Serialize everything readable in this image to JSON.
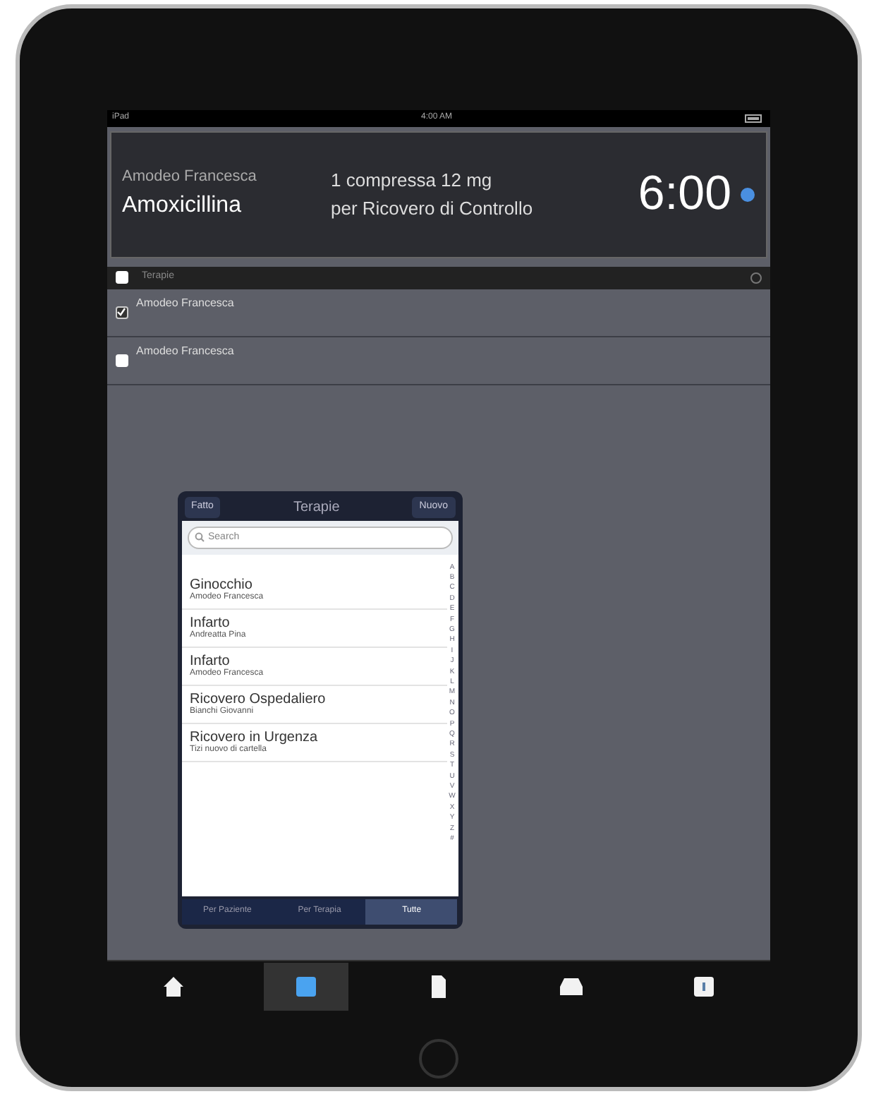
{
  "status_bar": {
    "device": "iPad",
    "time": "4:00 AM"
  },
  "next_dose": {
    "patient": "Amodeo Francesca",
    "drug": "Amoxicillina",
    "dose": "1 compressa 12 mg",
    "reason": "per Ricovero di Controllo",
    "time": "6:00"
  },
  "list_header": {
    "title": "Terapie",
    "checked": false
  },
  "rows": [
    {
      "name": "Amodeo Francesca",
      "checked": true
    },
    {
      "name": "Amodeo Francesca",
      "checked": false
    }
  ],
  "popover": {
    "title": "Terapie",
    "left_button": "Fatto",
    "right_button": "Nuovo",
    "search": {
      "placeholder": "Search"
    },
    "items": [
      {
        "title": "Ginocchio",
        "subtitle": "Amodeo Francesca"
      },
      {
        "title": "Infarto",
        "subtitle": "Andreatta Pina"
      },
      {
        "title": "Infarto",
        "subtitle": "Amodeo Francesca"
      },
      {
        "title": "Ricovero Ospedaliero",
        "subtitle": "Bianchi Giovanni"
      },
      {
        "title": "Ricovero in Urgenza",
        "subtitle": "Tizi nuovo di cartella"
      }
    ],
    "index": [
      "A",
      "B",
      "C",
      "D",
      "E",
      "F",
      "G",
      "H",
      "I",
      "J",
      "K",
      "L",
      "M",
      "N",
      "O",
      "P",
      "Q",
      "R",
      "S",
      "T",
      "U",
      "V",
      "W",
      "X",
      "Y",
      "Z",
      "#"
    ],
    "segments": [
      {
        "label": "Per Paziente",
        "selected": false
      },
      {
        "label": "Per Terapia",
        "selected": false
      },
      {
        "label": "Tutte",
        "selected": true
      }
    ]
  },
  "tab_bar": [
    {
      "kind": "home",
      "selected": false
    },
    {
      "kind": "calendar",
      "selected": true
    },
    {
      "kind": "document",
      "selected": false
    },
    {
      "kind": "inbox",
      "selected": false
    },
    {
      "kind": "box",
      "selected": false
    }
  ]
}
